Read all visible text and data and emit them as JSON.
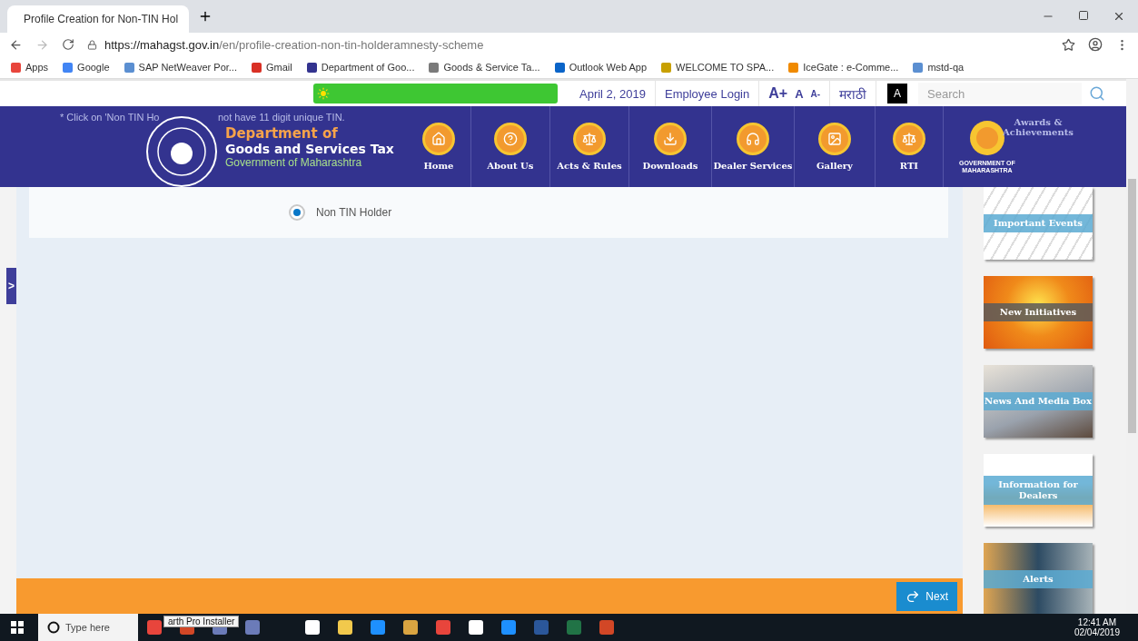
{
  "browser": {
    "tab_title": "Profile Creation for Non-TIN Hol",
    "url_host": "https://mahagst.gov.in",
    "url_path": "/en/profile-creation-non-tin-holderamnesty-scheme",
    "bookmarks": [
      {
        "label": "Apps",
        "color": "#e8453c"
      },
      {
        "label": "Google",
        "color": "#4285f4"
      },
      {
        "label": "SAP NetWeaver Por...",
        "color": "#5b8fd1"
      },
      {
        "label": "Gmail",
        "color": "#d93025"
      },
      {
        "label": "Department of Goo...",
        "color": "#33338f"
      },
      {
        "label": "Goods & Service Ta...",
        "color": "#7a7a7a"
      },
      {
        "label": "Outlook Web App",
        "color": "#0a64c8"
      },
      {
        "label": "WELCOME TO SPA...",
        "color": "#c8a000"
      },
      {
        "label": "IceGate : e-Comme...",
        "color": "#f08a00"
      },
      {
        "label": "mstd-qa",
        "color": "#5b8fd1"
      }
    ]
  },
  "utility_bar": {
    "date": "April 2, 2019",
    "employee_login": "Employee Login",
    "font_sizes": [
      "A+",
      "A",
      "A-"
    ],
    "language": "मराठी",
    "contrast": "A",
    "search": {
      "placeholder": "Search"
    }
  },
  "header": {
    "notice_parts": [
      "* Click on 'Non TIN Ho",
      "not have 11 digit unique TIN."
    ],
    "title_line1": "Department of",
    "title_line2": "Goods and Services Tax",
    "subtitle": "Government of Maharashtra",
    "nav": [
      {
        "label": "Home"
      },
      {
        "label": "About Us"
      },
      {
        "label": "Acts & Rules"
      },
      {
        "label": "Downloads"
      },
      {
        "label": "Dealer Services"
      },
      {
        "label": "Gallery"
      },
      {
        "label": "RTI"
      }
    ],
    "emblem_caption": "GOVERNMENT OF MAHARASHTRA",
    "awards": "Awards & Achievements"
  },
  "form": {
    "options": [
      {
        "label": "Non TIN Holder",
        "selected": true
      }
    ]
  },
  "side_tab": ">",
  "tiles": [
    {
      "label": "Important Events",
      "kind": "calendar"
    },
    {
      "label": "New Initiatives",
      "kind": "bulb"
    },
    {
      "label": "News And Media Box",
      "kind": "news"
    },
    {
      "label": "Information for Dealers",
      "kind": "dealers"
    },
    {
      "label": "Alerts",
      "kind": "clock"
    }
  ],
  "footer": {
    "next": "Next"
  },
  "taskbar": {
    "search": "Type here",
    "tooltip": "arth Pro Installer",
    "apps": [
      {
        "color": "#e8453c"
      },
      {
        "color": "#d24726"
      },
      {
        "color": "#6b7bb8"
      },
      {
        "color": "#6b7bb8"
      },
      {
        "color": "#ffffff"
      },
      {
        "color": "#f2c94c"
      },
      {
        "color": "#1e90ff"
      },
      {
        "color": "#d9a441"
      },
      {
        "color": "#e8453c"
      },
      {
        "color": "#ffffff"
      },
      {
        "color": "#1e90ff"
      },
      {
        "color": "#2b579a"
      },
      {
        "color": "#217346"
      },
      {
        "color": "#d24726"
      }
    ],
    "time": "12:41 AM",
    "date": "02/04/2019"
  }
}
